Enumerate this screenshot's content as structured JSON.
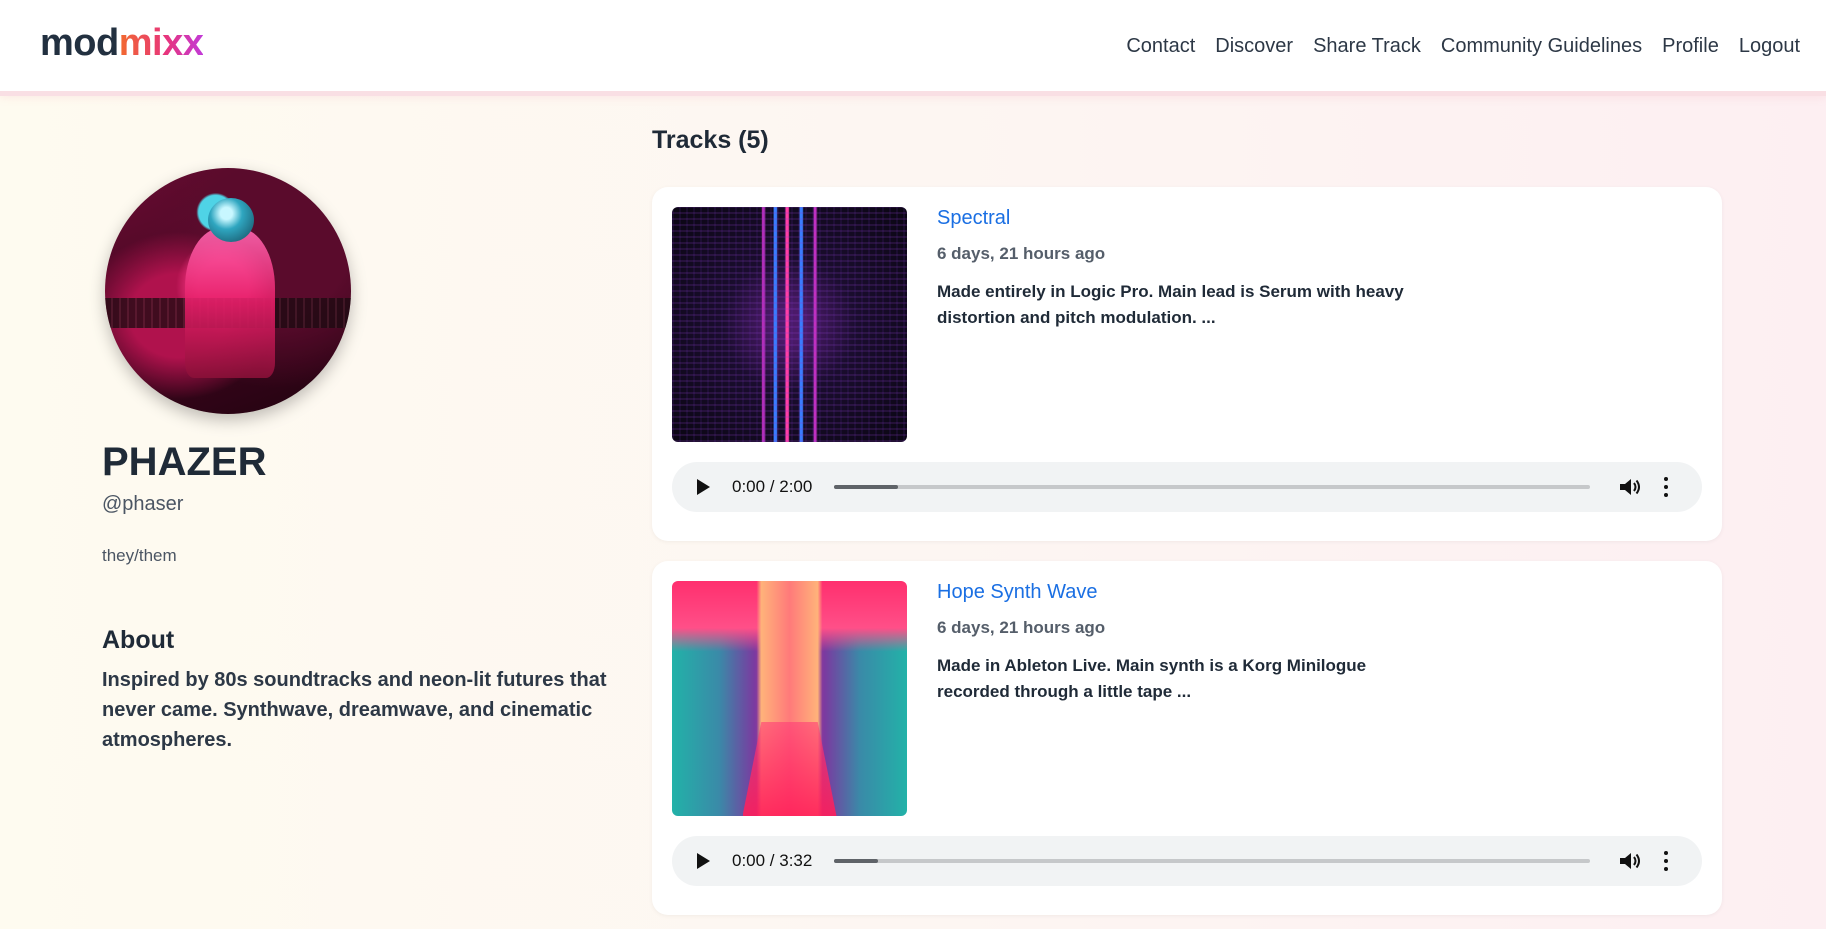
{
  "brand": {
    "part1": "mod",
    "part2": "mixx"
  },
  "nav": {
    "items": [
      {
        "label": "Contact"
      },
      {
        "label": "Discover"
      },
      {
        "label": "Share Track"
      },
      {
        "label": "Community Guidelines"
      },
      {
        "label": "Profile"
      },
      {
        "label": "Logout"
      }
    ]
  },
  "profile": {
    "avatar_icon": "avatar-photo",
    "display_name": "PHAZER",
    "handle": "@phaser",
    "pronouns": "they/them",
    "about_heading": "About",
    "about_text": "Inspired by 80s soundtracks and neon-lit futures that never came. Synthwave, dreamwave, and cinematic atmospheres."
  },
  "tracks": {
    "heading": "Tracks (5)",
    "items": [
      {
        "title": "Spectral",
        "time_ago": "6 days, 21 hours ago",
        "description": "Made entirely in Logic Pro. Main lead is Serum with heavy distortion and pitch modulation. ...",
        "player": {
          "time": "0:00 / 2:00",
          "buffered_fraction": 0.085
        }
      },
      {
        "title": "Hope Synth Wave",
        "time_ago": "6 days, 21 hours ago",
        "description": "Made in Ableton Live. Main synth is a Korg Minilogue recorded through a little tape ...",
        "player": {
          "time": "0:00 / 3:32",
          "buffered_fraction": 0.058
        }
      }
    ]
  },
  "colors": {
    "accent_link": "#1a6fe3",
    "brand_gradient_start": "#f26a2e",
    "brand_gradient_end": "#c23ad8"
  }
}
